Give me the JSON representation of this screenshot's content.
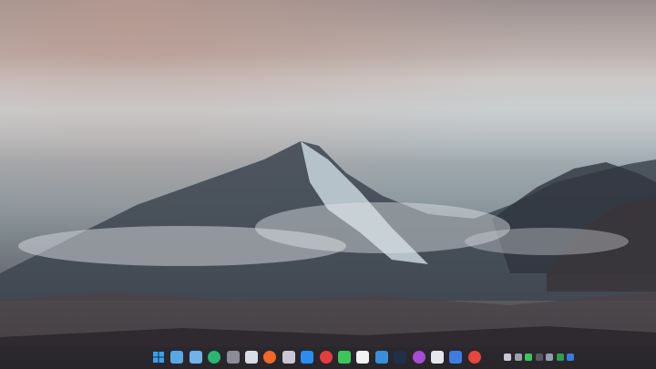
{
  "desktop": {
    "wallpaper": "misty-mountain-rain-drops"
  },
  "taskbar": {
    "background": "#28242a",
    "pinned_apps": [
      {
        "icon": "windows-start-icon",
        "color": "#3aa0f0"
      },
      {
        "icon": "desktop-icon",
        "color": "#5aa7e8"
      },
      {
        "icon": "mail-icon",
        "color": "#6fb3ea"
      },
      {
        "icon": "edge-browser-icon",
        "color": "#2bb673"
      },
      {
        "icon": "settings-gear-icon",
        "color": "#8c8c96"
      },
      {
        "icon": "file-explorer-icon",
        "color": "#d9dde6"
      },
      {
        "icon": "firefox-icon",
        "color": "#f2682a"
      },
      {
        "icon": "notepad-icon",
        "color": "#c8c8d2"
      },
      {
        "icon": "cloud-icon",
        "color": "#2d8cf0"
      },
      {
        "icon": "netease-music-icon",
        "color": "#e43d3d"
      },
      {
        "icon": "wechat-icon",
        "color": "#3bc65c"
      },
      {
        "icon": "typora-icon",
        "color": "#f2f2f2"
      },
      {
        "icon": "vscode-icon",
        "color": "#3a8fd8"
      },
      {
        "icon": "photoshop-icon",
        "color": "#1f3047"
      },
      {
        "icon": "app-purple-icon",
        "color": "#a64cd6"
      },
      {
        "icon": "docs-icon",
        "color": "#e6e6ee"
      },
      {
        "icon": "app-blue-icon",
        "color": "#3f7ee0"
      },
      {
        "icon": "chrome-icon",
        "color": "#e9453a"
      }
    ],
    "tray": [
      {
        "icon": "tray-app-icon",
        "color": "#c9c9d4"
      },
      {
        "icon": "tray-monitor-icon",
        "color": "#9aa0aa"
      },
      {
        "icon": "tray-wechat-icon",
        "color": "#3bc65c"
      },
      {
        "icon": "tray-dark-icon",
        "color": "#555a63"
      },
      {
        "icon": "tray-shield-icon",
        "color": "#8fa0b3"
      },
      {
        "icon": "tray-green-icon",
        "color": "#2f9e54"
      },
      {
        "icon": "bluetooth-icon",
        "color": "#3d78e0"
      }
    ]
  }
}
